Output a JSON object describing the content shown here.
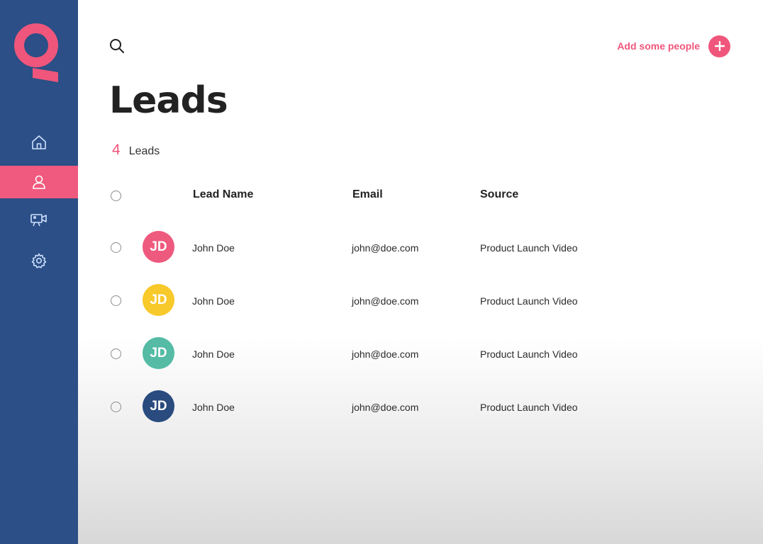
{
  "colors": {
    "sidebar": "#2b4f86",
    "accent": "#f0567b",
    "text": "#222222"
  },
  "sidebar": {
    "items": [
      {
        "icon": "home-icon",
        "active": false
      },
      {
        "icon": "user-icon",
        "active": true
      },
      {
        "icon": "video-camera-icon",
        "active": false
      },
      {
        "icon": "gear-icon",
        "active": false
      }
    ]
  },
  "header": {
    "add_label": "Add some people"
  },
  "page": {
    "title": "Leads",
    "count": "4",
    "count_label": "Leads"
  },
  "table": {
    "headers": [
      "Lead Name",
      "Email",
      "Source"
    ],
    "rows": [
      {
        "initials": "JD",
        "avatar_color": "#ee5a7e",
        "name": "John Doe",
        "email": "john@doe.com",
        "source": "Product Launch Video"
      },
      {
        "initials": "JD",
        "avatar_color": "#f8c92a",
        "name": "John Doe",
        "email": "john@doe.com",
        "source": "Product Launch Video"
      },
      {
        "initials": "JD",
        "avatar_color": "#55bba5",
        "name": "John Doe",
        "email": "john@doe.com",
        "source": "Product Launch Video"
      },
      {
        "initials": "JD",
        "avatar_color": "#294b7e",
        "name": "John Doe",
        "email": "john@doe.com",
        "source": "Product Launch Video"
      }
    ]
  }
}
